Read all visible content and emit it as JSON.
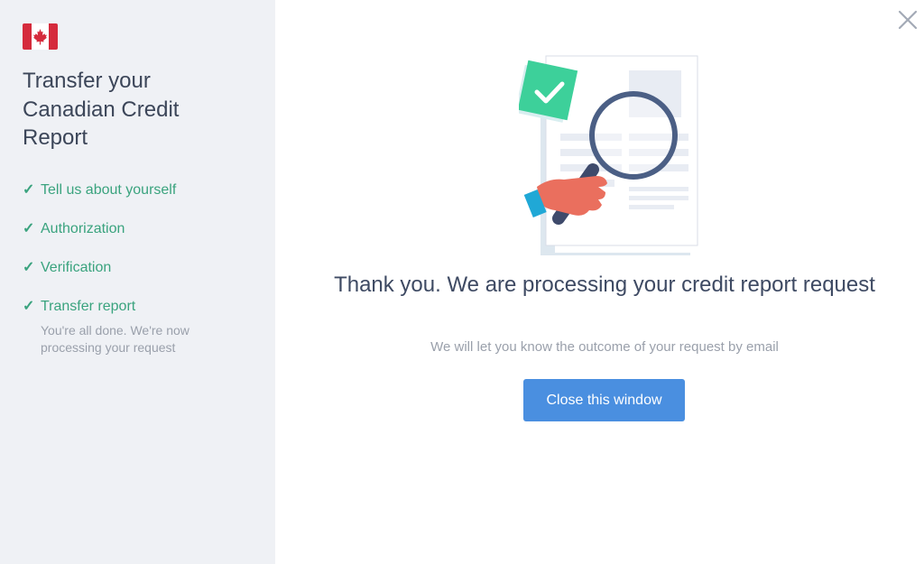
{
  "sidebar": {
    "flag_icon": "canada-flag-icon",
    "title": "Transfer your Canadian Credit Report",
    "check_icon": "checkmark-icon",
    "check_glyph": "✓",
    "steps": [
      {
        "label": "Tell us about yourself",
        "status": "complete"
      },
      {
        "label": "Authorization",
        "status": "complete"
      },
      {
        "label": "Verification",
        "status": "complete"
      },
      {
        "label": "Transfer report",
        "status": "complete",
        "description": "You're all done. We're now processing your request"
      }
    ]
  },
  "main": {
    "close_icon": "close-icon",
    "illustration": "document-magnifier-illustration",
    "heading": "Thank you. We are processing your credit report request",
    "subtext": "We will let you know the outcome of your request by email",
    "button_label": "Close this window"
  },
  "colors": {
    "accent_green": "#3aa37e",
    "button_blue": "#4a8fe0",
    "sidebar_bg": "#eff1f5",
    "flag_red": "#d52b3c"
  }
}
